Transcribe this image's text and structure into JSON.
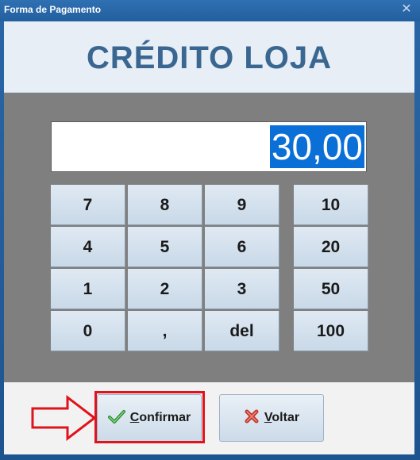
{
  "window": {
    "title": "Forma de Pagamento",
    "close_glyph": "✕"
  },
  "header": {
    "title": "CRÉDITO LOJA"
  },
  "amount": {
    "value": "30,00"
  },
  "keypad": {
    "rows": [
      [
        "7",
        "8",
        "9"
      ],
      [
        "4",
        "5",
        "6"
      ],
      [
        "1",
        "2",
        "3"
      ],
      [
        "0",
        ",",
        "del"
      ]
    ],
    "quick_values": [
      "10",
      "20",
      "50",
      "100"
    ]
  },
  "actions": {
    "confirm_label": "Confirmar",
    "confirm_mnemonic": "C",
    "confirm_rest": "onfirmar",
    "cancel_label": "Voltar",
    "cancel_mnemonic": "V",
    "cancel_rest": "oltar"
  },
  "icons": {
    "confirm": "check-icon",
    "cancel": "x-icon",
    "annotation": "red-arrow-icon"
  },
  "colors": {
    "title_bar": "#225f9d",
    "header_text": "#3a6791",
    "selection": "#0a6fd6",
    "annotation": "#e0121c"
  }
}
